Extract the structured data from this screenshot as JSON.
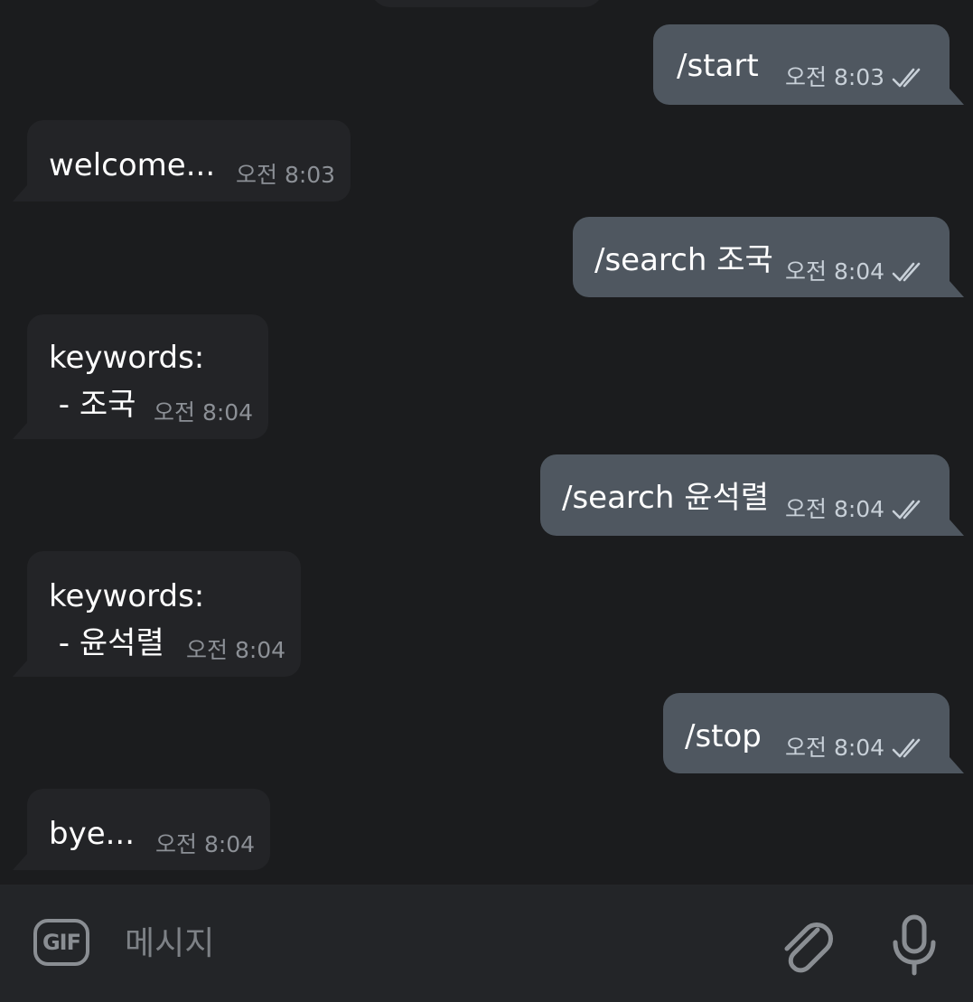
{
  "messages": [
    {
      "direction": "out",
      "text": "/start",
      "time": "오전 8:03"
    },
    {
      "direction": "in",
      "text": "welcome...",
      "time": "오전 8:03"
    },
    {
      "direction": "out",
      "text": "/search 조국",
      "time": "오전 8:04"
    },
    {
      "direction": "in",
      "text_line1": "keywords:",
      "text_line2": " - 조국",
      "time": "오전 8:04"
    },
    {
      "direction": "out",
      "text": "/search 윤석렬",
      "time": "오전 8:04"
    },
    {
      "direction": "in",
      "text_line1": "keywords:",
      "text_line2": " - 윤석렬",
      "time": "오전 8:04"
    },
    {
      "direction": "out",
      "text": "/stop",
      "time": "오전 8:04"
    },
    {
      "direction": "in",
      "text": "bye...",
      "time": "오전 8:04"
    }
  ],
  "composer": {
    "gif_label": "GIF",
    "placeholder": "메시지",
    "attach_icon": "paperclip-icon",
    "mic_icon": "microphone-icon"
  },
  "colors": {
    "background": "#1b1c1e",
    "incoming_bubble": "#232427",
    "outgoing_bubble": "#4f5760",
    "composer_bar": "#232528"
  }
}
